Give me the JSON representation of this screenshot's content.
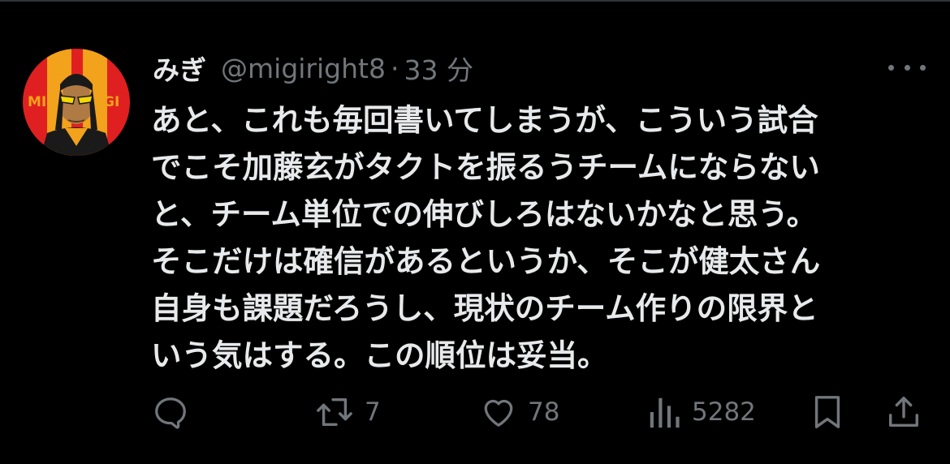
{
  "colors": {
    "background": "#000000",
    "text": "#e7e9ea",
    "muted": "#71767b",
    "avatar_red": "#e02020",
    "avatar_orange": "#f2a21b"
  },
  "avatar": {
    "icon": "avatar-icon",
    "left_letters": "MI",
    "right_letters": "GI"
  },
  "tweet": {
    "display_name": "みぎ",
    "handle": "@migiright8",
    "separator": "·",
    "time": "33 分",
    "more_icon": "more-dots-icon",
    "text": "あと、これも毎回書いてしまうが、こういう試合\nでこそ加藤玄がタクトを振るうチームにならない\nと、チーム単位での伸びしろはないかなと思う。\nそこだけは確信があるというか、そこが健太さん\n自身も課題だろうし、現状のチーム作りの限界と\nいう気はする。この順位は妥当。"
  },
  "actions": {
    "reply": {
      "icon": "reply-icon"
    },
    "retweet": {
      "icon": "retweet-icon",
      "count": "7"
    },
    "like": {
      "icon": "heart-icon",
      "count": "78"
    },
    "views": {
      "icon": "views-icon",
      "count": "5282"
    },
    "bookmark": {
      "icon": "bookmark-icon"
    },
    "share": {
      "icon": "share-icon"
    }
  }
}
